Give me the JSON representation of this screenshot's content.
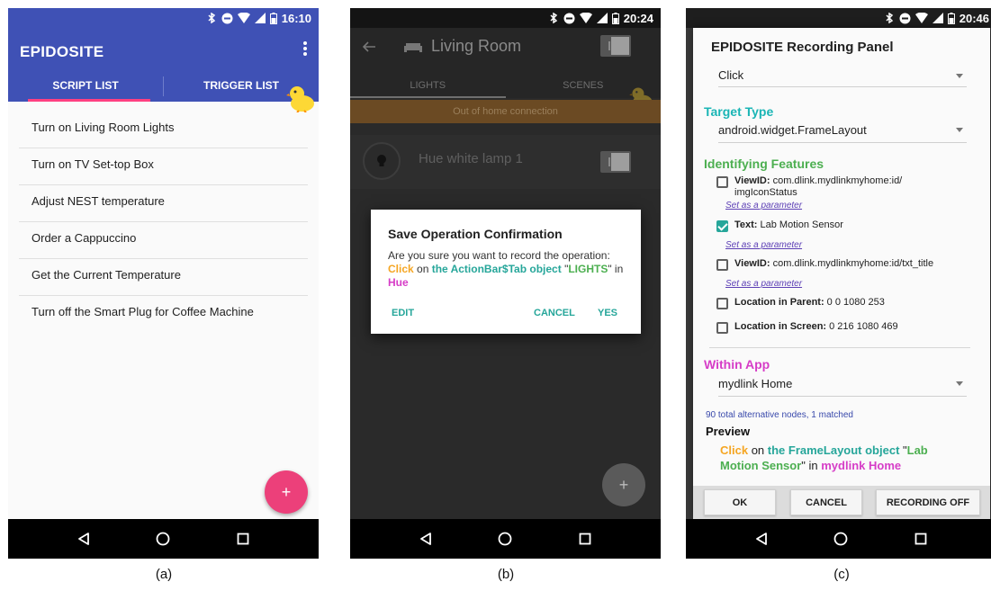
{
  "captions": [
    "(a)",
    "(b)",
    "(c)"
  ],
  "phone_a": {
    "time": "16:10",
    "app_title": "EPIDOSITE",
    "tabs": [
      "SCRIPT LIST",
      "TRIGGER LIST"
    ],
    "scripts": [
      "Turn on Living Room Lights",
      "Turn on TV Set-top Box",
      "Adjust NEST temperature",
      "Order a Cappuccino",
      "Get the Current Temperature",
      "Turn off the Smart Plug for Coffee Machine"
    ],
    "fab_label": "+",
    "colors": {
      "primary": "#3f51b5",
      "accent": "#ec407a"
    }
  },
  "phone_b": {
    "time": "20:24",
    "room_title": "Living Room",
    "tabs": [
      "LIGHTS",
      "SCENES"
    ],
    "warning": "Out of home connection",
    "lamp_name": "Hue white lamp 1",
    "dialog": {
      "title": "Save Operation Confirmation",
      "text_1": "Are you sure you want to record the operation: ",
      "action": "Click",
      "text_2": " on ",
      "target": "the ActionBar$Tab object",
      "text_3": " \"",
      "label": "LIGHTS",
      "text_4": "\" in ",
      "app": "Hue",
      "edit": "EDIT",
      "cancel": "CANCEL",
      "yes": "YES"
    },
    "fab_label": "+"
  },
  "phone_c": {
    "time": "20:46",
    "panel_title": "EPIDOSITE Recording Panel",
    "action_value": "Click",
    "target_type_label": "Target Type",
    "target_type_value": "android.widget.FrameLayout",
    "identifying_label": "Identifying Features",
    "features": [
      {
        "key": "ViewID:",
        "value": " com.dlink.mydlinkmyhome:id/",
        "value2": "imgIconStatus",
        "checked": false,
        "param": "Set as a parameter"
      },
      {
        "key": "Text:",
        "value": " Lab Motion Sensor",
        "checked": true,
        "param": "Set as a parameter"
      },
      {
        "key": "ViewID:",
        "value": " com.dlink.mydlinkmyhome:id/txt_title",
        "checked": false,
        "param": "Set as a parameter"
      },
      {
        "key": "Location in Parent:",
        "value": " 0 0 1080 253",
        "checked": false
      },
      {
        "key": "Location in Screen:",
        "value": " 0 216 1080 469",
        "checked": false
      }
    ],
    "within_app_label": "Within App",
    "within_app_value": "mydlink Home",
    "alt_info": "90 total alternative nodes, 1 matched",
    "preview_label": "Preview",
    "preview": {
      "action": "Click",
      "on": " on ",
      "target": "the FrameLayout object",
      "q1": " \"",
      "label": "Lab Motion Sensor",
      "q2": "\" in ",
      "app": "mydlink Home"
    },
    "buttons": {
      "ok": "OK",
      "cancel": "CANCEL",
      "recording_off": "RECORDING OFF"
    }
  }
}
